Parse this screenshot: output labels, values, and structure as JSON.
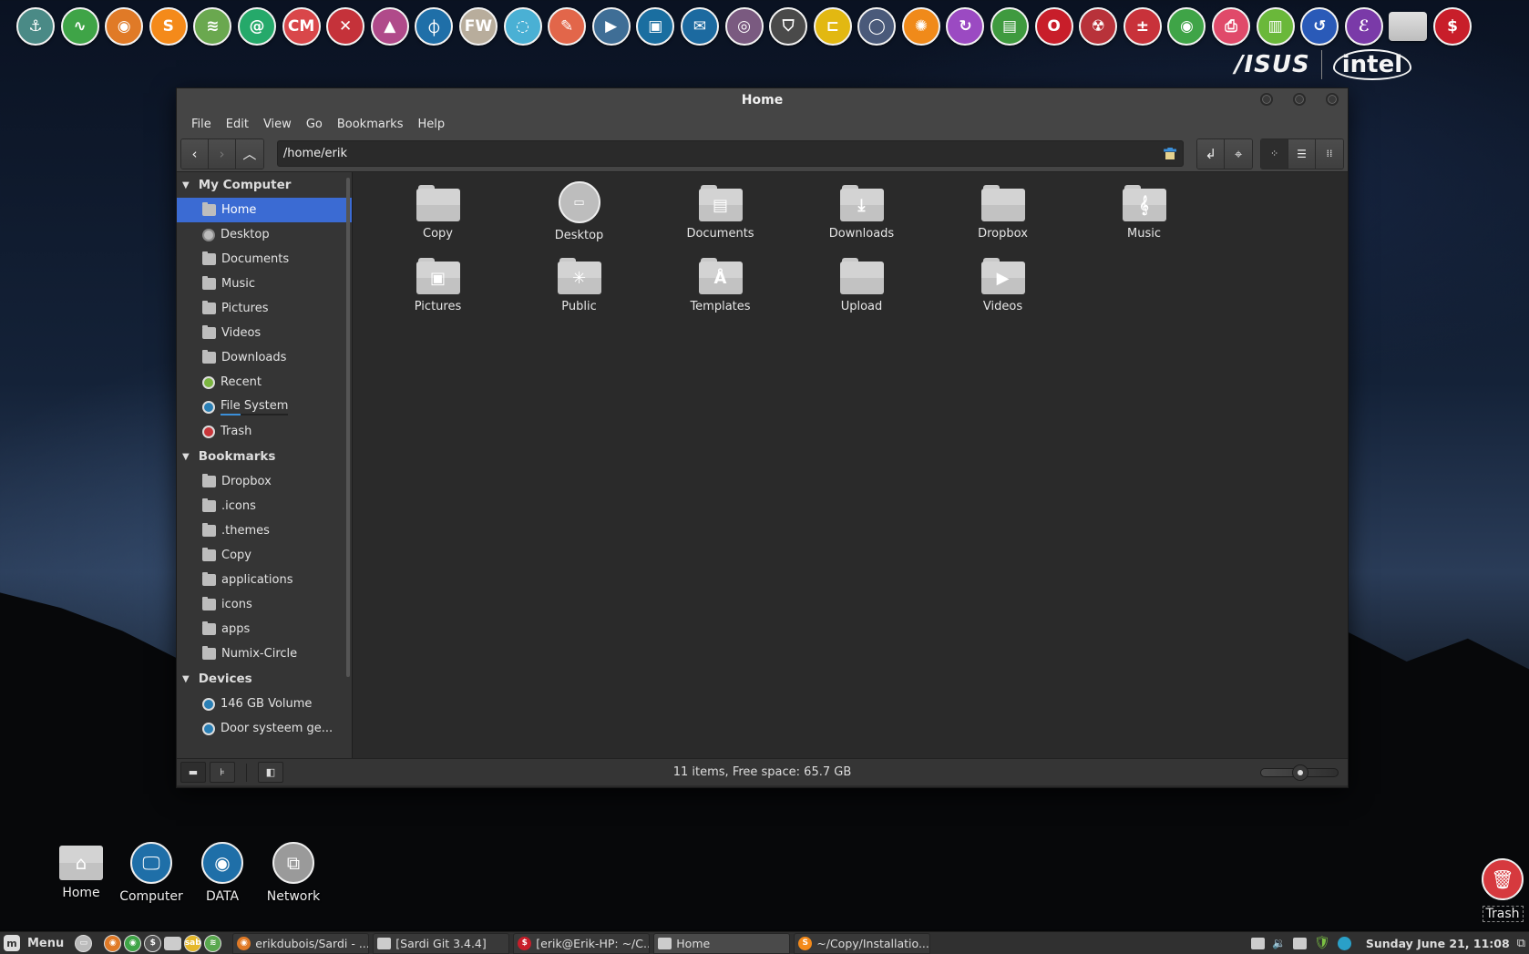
{
  "dock": {
    "items": [
      {
        "name": "anchor-icon",
        "glyph": "⚓",
        "color": "#4a8a86"
      },
      {
        "name": "system-monitor-icon",
        "glyph": "∿",
        "color": "#3fa447"
      },
      {
        "name": "firefox-icon",
        "glyph": "◉",
        "color": "#e07a27"
      },
      {
        "name": "sublime-text-icon",
        "glyph": "S",
        "color": "#f48a1a"
      },
      {
        "name": "spotify-icon",
        "glyph": "≋",
        "color": "#6aa84f"
      },
      {
        "name": "email-icon",
        "glyph": "@",
        "color": "#25a96a"
      },
      {
        "name": "cm-icon",
        "glyph": "CM",
        "color": "#d9474a"
      },
      {
        "name": "tools-icon",
        "glyph": "✕",
        "color": "#c5323a"
      },
      {
        "name": "inkscape-icon",
        "glyph": "▲",
        "color": "#b04a8a"
      },
      {
        "name": "mixer-icon",
        "glyph": "⏀",
        "color": "#1f6fa8"
      },
      {
        "name": "fw-icon",
        "glyph": "FW",
        "color": "#b8ad9c"
      },
      {
        "name": "screenshot-icon",
        "glyph": "◌",
        "color": "#4ab0d4"
      },
      {
        "name": "text-editor-icon",
        "glyph": "✎",
        "color": "#e2664a"
      },
      {
        "name": "video-player-icon",
        "glyph": "▶",
        "color": "#3f6e96"
      },
      {
        "name": "image-viewer-icon",
        "glyph": "▣",
        "color": "#1a6ea0"
      },
      {
        "name": "thunderbird-icon",
        "glyph": "✉",
        "color": "#1c6aa0"
      },
      {
        "name": "disc-burner-icon",
        "glyph": "◎",
        "color": "#7a5a80"
      },
      {
        "name": "shield-icon",
        "glyph": "⛉",
        "color": "#4a4a4a"
      },
      {
        "name": "ruler-icon",
        "glyph": "⊏",
        "color": "#e2b812"
      },
      {
        "name": "network-manager-icon",
        "glyph": "◯",
        "color": "#4a5a7a"
      },
      {
        "name": "orange-wheel-icon",
        "glyph": "✺",
        "color": "#f08a1a"
      },
      {
        "name": "disk-utility-icon",
        "glyph": "↻",
        "color": "#9b4ac2"
      },
      {
        "name": "hardware-card-icon",
        "glyph": "▤",
        "color": "#3f9a3f"
      },
      {
        "name": "opera-icon",
        "glyph": "O",
        "color": "#c81e2a"
      },
      {
        "name": "radiation-icon",
        "glyph": "☢",
        "color": "#b8323a"
      },
      {
        "name": "calculator-icon",
        "glyph": "±",
        "color": "#c8323a"
      },
      {
        "name": "chrome-icon",
        "glyph": "◉",
        "color": "#3fa447"
      },
      {
        "name": "printer-icon",
        "glyph": "⎙",
        "color": "#e04a6a"
      },
      {
        "name": "book-reader-icon",
        "glyph": "▥",
        "color": "#6ab83a"
      },
      {
        "name": "backup-icon",
        "glyph": "↺",
        "color": "#2a5ab8"
      },
      {
        "name": "emacs-icon",
        "glyph": "ℰ",
        "color": "#7a3aa8"
      },
      {
        "name": "folder-icon",
        "glyph": "",
        "color": "#cccccc",
        "folder": true
      },
      {
        "name": "terminal-icon",
        "glyph": "$",
        "color": "#c81e2a"
      }
    ]
  },
  "brand": {
    "asus": "/ISUS",
    "intel": "intel"
  },
  "window": {
    "title": "Home",
    "menu": [
      "File",
      "Edit",
      "View",
      "Go",
      "Bookmarks",
      "Help"
    ],
    "location": "/home/erik",
    "sidebar": {
      "sections": [
        {
          "title": "My Computer",
          "items": [
            {
              "label": "Home",
              "icon": "home-icon",
              "kind": "folder",
              "selected": true
            },
            {
              "label": "Desktop",
              "icon": "desktop-icon",
              "kind": "circle gray"
            },
            {
              "label": "Documents",
              "icon": "documents-icon",
              "kind": "folder"
            },
            {
              "label": "Music",
              "icon": "music-icon",
              "kind": "folder"
            },
            {
              "label": "Pictures",
              "icon": "pictures-icon",
              "kind": "folder"
            },
            {
              "label": "Videos",
              "icon": "videos-icon",
              "kind": "folder"
            },
            {
              "label": "Downloads",
              "icon": "downloads-icon",
              "kind": "folder"
            },
            {
              "label": "Recent",
              "icon": "recent-icon",
              "kind": "circle green"
            },
            {
              "label": "File System",
              "icon": "drive-icon",
              "kind": "circle blue",
              "usage_fraction": 0.3
            },
            {
              "label": "Trash",
              "icon": "trash-icon",
              "kind": "circle red"
            }
          ]
        },
        {
          "title": "Bookmarks",
          "items": [
            {
              "label": "Dropbox",
              "icon": "folder-icon",
              "kind": "folder"
            },
            {
              "label": ".icons",
              "icon": "folder-icon",
              "kind": "folder"
            },
            {
              "label": ".themes",
              "icon": "folder-icon",
              "kind": "folder"
            },
            {
              "label": "Copy",
              "icon": "folder-icon",
              "kind": "folder"
            },
            {
              "label": "applications",
              "icon": "folder-icon",
              "kind": "folder"
            },
            {
              "label": "icons",
              "icon": "folder-icon",
              "kind": "folder"
            },
            {
              "label": "apps",
              "icon": "folder-icon",
              "kind": "folder"
            },
            {
              "label": "Numix-Circle",
              "icon": "folder-icon",
              "kind": "folder"
            }
          ]
        },
        {
          "title": "Devices",
          "items": [
            {
              "label": "146 GB Volume",
              "icon": "drive-icon",
              "kind": "circle blue"
            },
            {
              "label": "Door systeem ge...",
              "icon": "drive-icon",
              "kind": "circle blue"
            }
          ]
        }
      ]
    },
    "files": [
      {
        "label": "Copy",
        "icon": "folder-icon",
        "glyph": ""
      },
      {
        "label": "Desktop",
        "icon": "desktop-icon",
        "glyph": "▭",
        "desktop": true
      },
      {
        "label": "Documents",
        "icon": "documents-folder-icon",
        "glyph": "▤"
      },
      {
        "label": "Downloads",
        "icon": "downloads-folder-icon",
        "glyph": "⤓"
      },
      {
        "label": "Dropbox",
        "icon": "folder-icon",
        "glyph": ""
      },
      {
        "label": "Music",
        "icon": "music-folder-icon",
        "glyph": "𝄞"
      },
      {
        "label": "Pictures",
        "icon": "pictures-folder-icon",
        "glyph": "▣"
      },
      {
        "label": "Public",
        "icon": "public-folder-icon",
        "glyph": "✳"
      },
      {
        "label": "Templates",
        "icon": "templates-folder-icon",
        "glyph": "Å"
      },
      {
        "label": "Upload",
        "icon": "folder-icon",
        "glyph": ""
      },
      {
        "label": "Videos",
        "icon": "videos-folder-icon",
        "glyph": "▶"
      }
    ],
    "status": "11 items, Free space: 65.7 GB",
    "zoom_level_fraction": 0.5
  },
  "desktop_icons": [
    {
      "label": "Home",
      "icon": "home-folder-icon",
      "glyph": "⌂",
      "type": "folder"
    },
    {
      "label": "Computer",
      "icon": "computer-icon",
      "glyph": "🖵",
      "type": "circle",
      "color": "#1f6fa8"
    },
    {
      "label": "DATA",
      "icon": "drive-icon",
      "glyph": "◉",
      "type": "circle",
      "color": "#1f6fa8"
    },
    {
      "label": "Network",
      "icon": "network-icon",
      "glyph": "⧉",
      "type": "circle",
      "color": "#9a9a9a"
    }
  ],
  "desktop_trash": {
    "label": "Trash"
  },
  "taskbar": {
    "menu_label": "Menu",
    "quick_launch": [
      {
        "name": "show-desktop-icon",
        "glyph": "▭",
        "color": "#bbbbbb"
      },
      {
        "name": "firefox-icon",
        "glyph": "◉",
        "color": "#e07a27"
      },
      {
        "name": "chrome-icon",
        "glyph": "◉",
        "color": "#3fa447"
      },
      {
        "name": "terminal-icon",
        "glyph": "$",
        "color": "#555555"
      },
      {
        "name": "files-icon",
        "glyph": "",
        "color": "#cccccc",
        "folder": true
      },
      {
        "name": "sabnzbd-icon",
        "glyph": "sab",
        "color": "#e5b82a"
      },
      {
        "name": "spotify-icon",
        "glyph": "≋",
        "color": "#5aa84f"
      }
    ],
    "tasks": [
      {
        "label": "erikdubois/Sardi - ...",
        "icon": "firefox-icon",
        "color": "#e07a27",
        "glyph": "◉"
      },
      {
        "label": "[Sardi Git 3.4.4]",
        "icon": "folder-icon",
        "folder": true
      },
      {
        "label": "[erik@Erik-HP: ~/C...",
        "icon": "terminal-icon",
        "color": "#c81e2a",
        "glyph": "$"
      },
      {
        "label": "Home",
        "icon": "folder-icon",
        "folder": true,
        "active": true
      },
      {
        "label": "~/Copy/Installatio...",
        "icon": "sublime-text-icon",
        "color": "#f48a1a",
        "glyph": "S"
      }
    ],
    "tray": [
      "display-icon",
      "volume-icon",
      "disk-icon",
      "update-shield-icon",
      "dropbox-icon"
    ],
    "clock": "Sunday June 21, 11:08"
  }
}
